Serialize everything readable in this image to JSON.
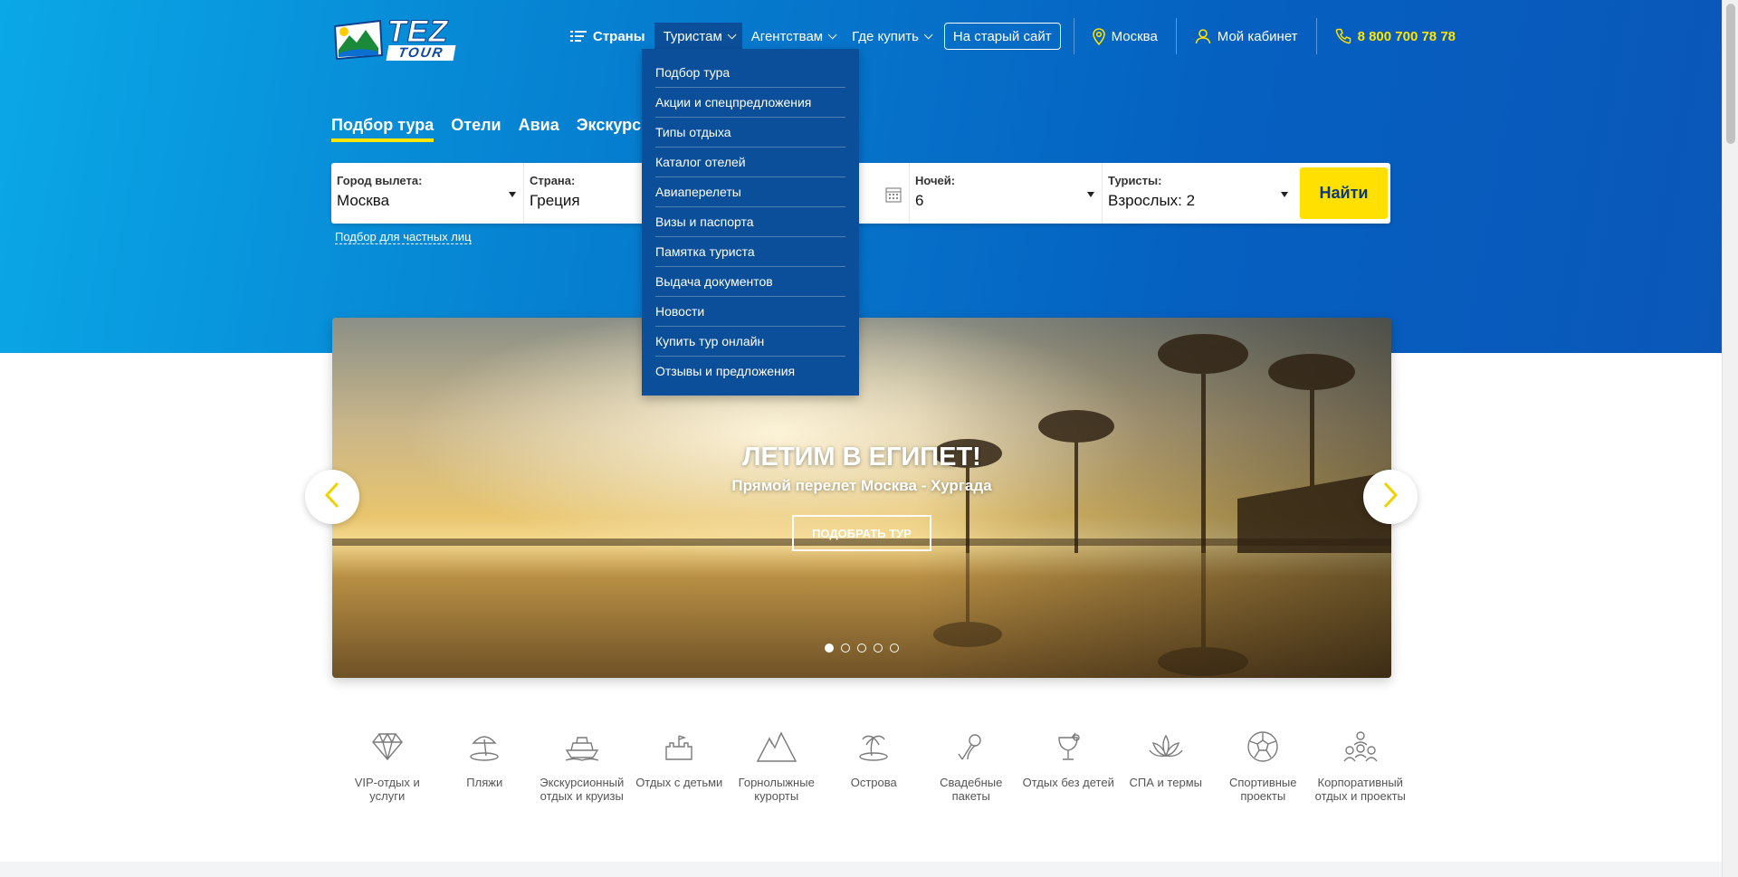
{
  "header": {
    "logo_top": "TEZ",
    "logo_bottom": "TOUR",
    "nav": {
      "countries": "Страны",
      "tourists": "Туристам",
      "agencies": "Агентствам",
      "where_buy": "Где купить",
      "old_site": "На старый сайт",
      "city": "Москва",
      "cabinet": "Мой кабинет",
      "phone": "8 800 700 78 78"
    }
  },
  "dropdown": {
    "items": [
      "Подбор тура",
      "Акции и спецпредложения",
      "Типы отдыха",
      "Каталог отелей",
      "Авиаперелеты",
      "Визы и паспорта",
      "Памятка туриста",
      "Выдача документов",
      "Новости",
      "Купить тур онлайн",
      "Отзывы и предложения"
    ]
  },
  "tabs": [
    "Подбор тура",
    "Отели",
    "Авиа",
    "Экскурсии"
  ],
  "search": {
    "departure_label": "Город вылета:",
    "departure_value": "Москва",
    "country_label": "Страна:",
    "country_value": "Греция",
    "nights_label": "Ночей:",
    "nights_value": "6",
    "tourists_label": "Туристы:",
    "tourists_value": "Взрослых: 2",
    "find_button": "Найти",
    "private_link": "Подбор для частных лиц"
  },
  "slider": {
    "title": "ЛЕТИМ В ЕГИПЕТ!",
    "subtitle": "Прямой перелет Москва - Хургада",
    "button": "ПОДОБРАТЬ ТУР",
    "dots_count": 5,
    "active_dot": 1
  },
  "categories": [
    {
      "label": "VIP-отдых и услуги",
      "icon": "diamond-icon"
    },
    {
      "label": "Пляжи",
      "icon": "beach-umbrella-icon"
    },
    {
      "label": "Экскурсионный отдых и круизы",
      "icon": "cruise-ship-icon"
    },
    {
      "label": "Отдых с детьми",
      "icon": "sandcastle-icon"
    },
    {
      "label": "Горнолыжные курорты",
      "icon": "mountains-icon"
    },
    {
      "label": "Острова",
      "icon": "palm-island-icon"
    },
    {
      "label": "Свадебные пакеты",
      "icon": "wedding-icon"
    },
    {
      "label": "Отдых без детей",
      "icon": "cocktail-icon"
    },
    {
      "label": "СПА и термы",
      "icon": "lotus-icon"
    },
    {
      "label": "Спортивные проекты",
      "icon": "soccer-ball-icon"
    },
    {
      "label": "Корпоративный отдых и проекты",
      "icon": "team-icon"
    }
  ],
  "colors": {
    "brand_blue": "#0560c0",
    "accent_yellow": "#ffe000",
    "dropdown_bg": "#0b4f9a"
  }
}
